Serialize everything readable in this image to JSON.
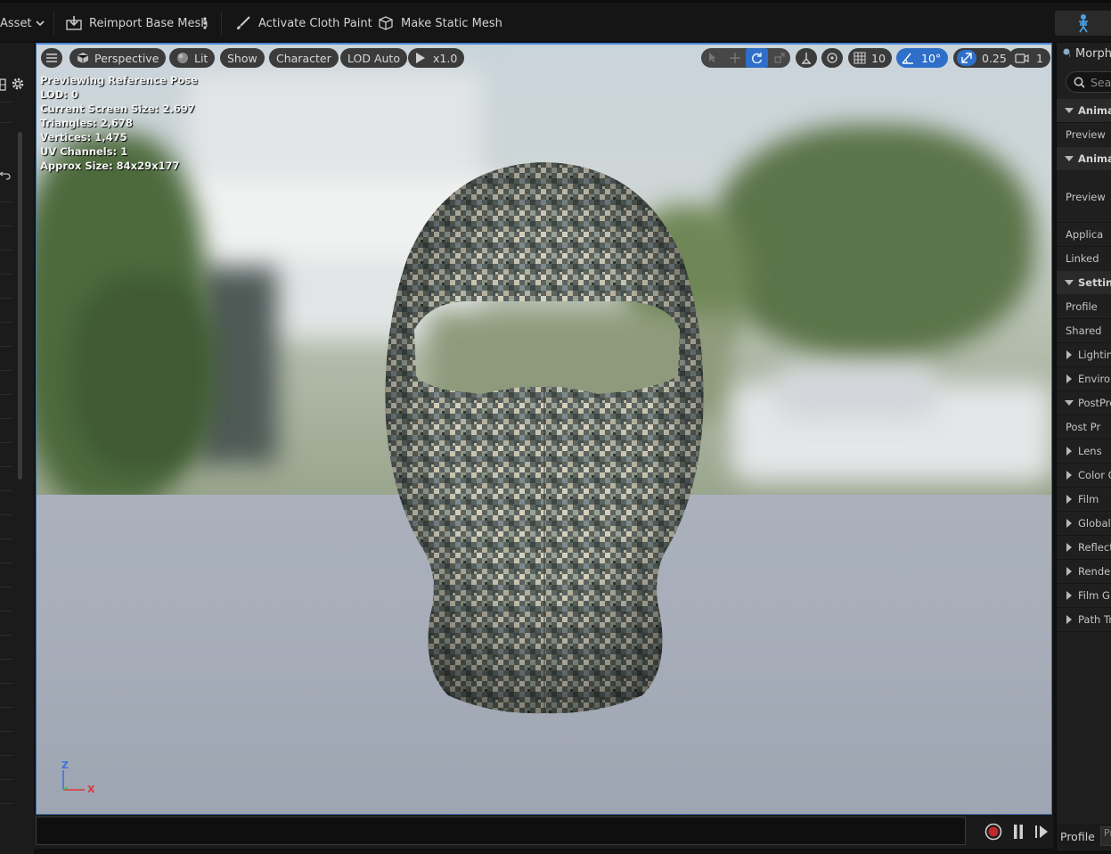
{
  "toolbar": {
    "asset_label": "Asset",
    "reimport_label": "Reimport Base Mesh",
    "cloth_paint_label": "Activate Cloth Paint",
    "static_mesh_label": "Make Static Mesh"
  },
  "viewport": {
    "menu_icon": "hamburger-icon",
    "perspective_label": "Perspective",
    "lit_label": "Lit",
    "show_label": "Show",
    "character_label": "Character",
    "lod_label": "LOD Auto",
    "speed_label": "x1.0",
    "grid_snap_value": "10",
    "rotation_snap_value": "10°",
    "scale_snap_value": "0.25",
    "camera_speed_value": "1",
    "accent_color": "#2f6fc9",
    "stats": {
      "line1": "Previewing Reference Pose",
      "line2": "LOD: 0",
      "line3": "Current Screen Size: 2.697",
      "line4": "Triangles: 2,678",
      "line5": "Vertices: 1,475",
      "line6": "UV Channels: 1",
      "line7": "Approx Size: 84x29x177"
    },
    "axis": {
      "z": "Z",
      "x": "X"
    }
  },
  "right_panel": {
    "header": "Morph",
    "search_placeholder": "Sea",
    "rows": [
      {
        "label": "Animat",
        "kind": "category",
        "expanded": true
      },
      {
        "label": "Preview",
        "kind": "item"
      },
      {
        "label": "Animat",
        "kind": "category",
        "expanded": true
      },
      {
        "label": "Preview",
        "kind": "item"
      },
      {
        "label": "Applica",
        "kind": "item"
      },
      {
        "label": "Linked",
        "kind": "item"
      },
      {
        "label": "Setting",
        "kind": "category",
        "expanded": true
      },
      {
        "label": "Profile",
        "kind": "item"
      },
      {
        "label": "Shared",
        "kind": "item"
      },
      {
        "label": "Lighting",
        "kind": "collapsed"
      },
      {
        "label": "Environ",
        "kind": "collapsed"
      },
      {
        "label": "PostPro",
        "kind": "expanded"
      },
      {
        "label": "Post Pr",
        "kind": "item"
      },
      {
        "label": "Lens",
        "kind": "collapsed"
      },
      {
        "label": "Color G",
        "kind": "collapsed"
      },
      {
        "label": "Film",
        "kind": "collapsed"
      },
      {
        "label": "Global I",
        "kind": "collapsed"
      },
      {
        "label": "Reflect",
        "kind": "collapsed"
      },
      {
        "label": "Render",
        "kind": "collapsed"
      },
      {
        "label": "Film Gr",
        "kind": "collapsed"
      },
      {
        "label": "Path Tr",
        "kind": "collapsed"
      }
    ],
    "profile_label": "Profile",
    "profile_value": "Pr"
  }
}
